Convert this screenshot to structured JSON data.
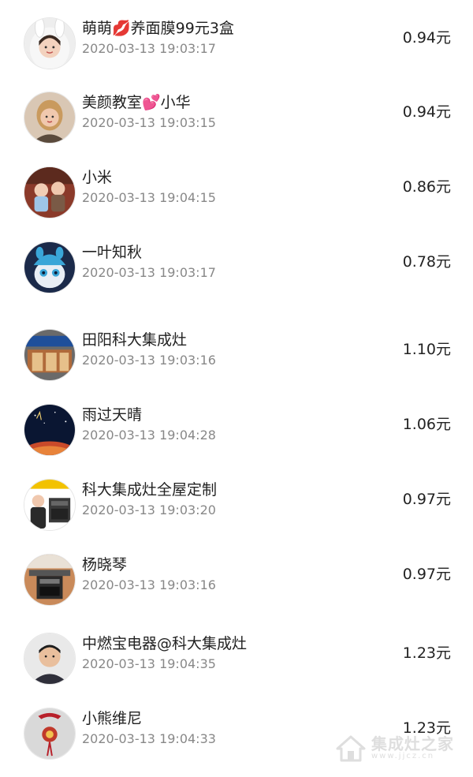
{
  "records": [
    {
      "name": "萌萌💋养面膜99元3盒",
      "time": "2020-03-13 19:03:17",
      "amount": "0.94元",
      "avatar": "avatar-girl-bunny-hood"
    },
    {
      "name": "美颜教室💕小华",
      "time": "2020-03-13 19:03:15",
      "amount": "0.94元",
      "avatar": "avatar-woman-portrait"
    },
    {
      "name": "小米",
      "time": "2020-03-13 19:04:15",
      "amount": "0.86元",
      "avatar": "avatar-two-children"
    },
    {
      "name": "一叶知秋",
      "time": "2020-03-13 19:03:17",
      "amount": "0.78元",
      "avatar": "avatar-cartoon-cat-blue-hat"
    },
    {
      "name": "田阳科大集成灶",
      "time": "2020-03-13 19:03:16",
      "amount": "1.10元",
      "avatar": "avatar-storefront"
    },
    {
      "name": "雨过天晴",
      "time": "2020-03-13 19:04:28",
      "amount": "1.06元",
      "avatar": "avatar-night-sky-earth"
    },
    {
      "name": "科大集成灶全屋定制",
      "time": "2020-03-13 19:03:20",
      "amount": "0.97元",
      "avatar": "avatar-woman-with-stove"
    },
    {
      "name": "杨晓琴",
      "time": "2020-03-13 19:03:16",
      "amount": "0.97元",
      "avatar": "avatar-kitchen-stove"
    },
    {
      "name": "中燃宝电器@科大集成灶",
      "time": "2020-03-13 19:04:35",
      "amount": "1.23元",
      "avatar": "avatar-man-portrait"
    },
    {
      "name": "小熊维尼",
      "time": "2020-03-13 19:04:33",
      "amount": "1.23元",
      "avatar": "avatar-red-ornament"
    }
  ],
  "watermark": {
    "title": "集成灶之家",
    "url": "www.jjcz.cn",
    "icon": "house-icon"
  },
  "colors": {
    "name_text": "#222222",
    "time_text": "#888888",
    "heart": "#e24b8c"
  }
}
